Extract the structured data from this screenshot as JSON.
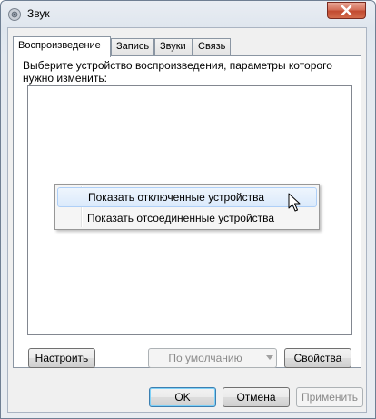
{
  "window": {
    "title": "Звук"
  },
  "tabs": [
    {
      "label": "Воспроизведение",
      "active": true
    },
    {
      "label": "Запись",
      "active": false
    },
    {
      "label": "Звуки",
      "active": false
    },
    {
      "label": "Связь",
      "active": false
    }
  ],
  "playback": {
    "instruction": "Выберите устройство воспроизведения, параметры которого нужно изменить:"
  },
  "context_menu": {
    "items": [
      {
        "label": "Показать отключенные устройства",
        "highlighted": true
      },
      {
        "label": "Показать отсоединенные устройства",
        "highlighted": false
      }
    ]
  },
  "panel_buttons": {
    "configure": "Настроить",
    "set_default": "По умолчанию",
    "properties": "Свойства"
  },
  "dialog_buttons": {
    "ok": "OK",
    "cancel": "Отмена",
    "apply": "Применить"
  },
  "icons": {
    "app": "speaker-icon",
    "close": "close-icon",
    "dropdown": "chevron-down-icon",
    "cursor": "mouse-pointer-icon"
  }
}
